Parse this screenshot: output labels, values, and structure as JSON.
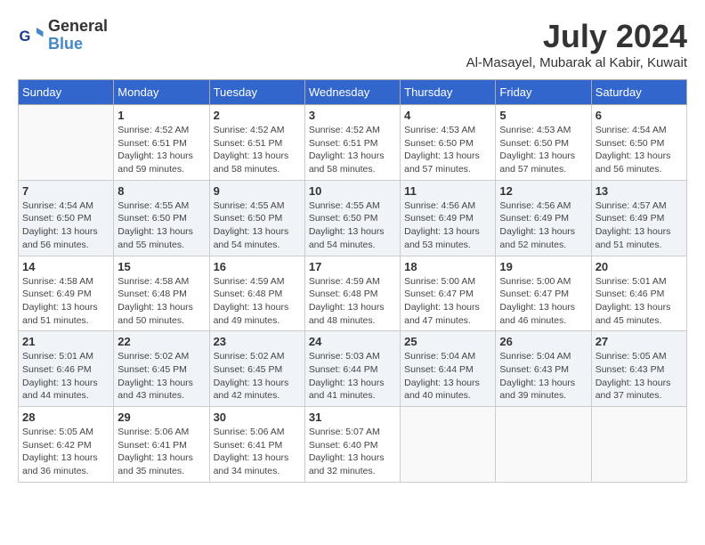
{
  "header": {
    "logo_line1": "General",
    "logo_line2": "Blue",
    "month": "July 2024",
    "location": "Al-Masayel, Mubarak al Kabir, Kuwait"
  },
  "days_of_week": [
    "Sunday",
    "Monday",
    "Tuesday",
    "Wednesday",
    "Thursday",
    "Friday",
    "Saturday"
  ],
  "weeks": [
    [
      {
        "day": "",
        "info": ""
      },
      {
        "day": "1",
        "info": "Sunrise: 4:52 AM\nSunset: 6:51 PM\nDaylight: 13 hours\nand 59 minutes."
      },
      {
        "day": "2",
        "info": "Sunrise: 4:52 AM\nSunset: 6:51 PM\nDaylight: 13 hours\nand 58 minutes."
      },
      {
        "day": "3",
        "info": "Sunrise: 4:52 AM\nSunset: 6:51 PM\nDaylight: 13 hours\nand 58 minutes."
      },
      {
        "day": "4",
        "info": "Sunrise: 4:53 AM\nSunset: 6:50 PM\nDaylight: 13 hours\nand 57 minutes."
      },
      {
        "day": "5",
        "info": "Sunrise: 4:53 AM\nSunset: 6:50 PM\nDaylight: 13 hours\nand 57 minutes."
      },
      {
        "day": "6",
        "info": "Sunrise: 4:54 AM\nSunset: 6:50 PM\nDaylight: 13 hours\nand 56 minutes."
      }
    ],
    [
      {
        "day": "7",
        "info": "Sunrise: 4:54 AM\nSunset: 6:50 PM\nDaylight: 13 hours\nand 56 minutes."
      },
      {
        "day": "8",
        "info": "Sunrise: 4:55 AM\nSunset: 6:50 PM\nDaylight: 13 hours\nand 55 minutes."
      },
      {
        "day": "9",
        "info": "Sunrise: 4:55 AM\nSunset: 6:50 PM\nDaylight: 13 hours\nand 54 minutes."
      },
      {
        "day": "10",
        "info": "Sunrise: 4:55 AM\nSunset: 6:50 PM\nDaylight: 13 hours\nand 54 minutes."
      },
      {
        "day": "11",
        "info": "Sunrise: 4:56 AM\nSunset: 6:49 PM\nDaylight: 13 hours\nand 53 minutes."
      },
      {
        "day": "12",
        "info": "Sunrise: 4:56 AM\nSunset: 6:49 PM\nDaylight: 13 hours\nand 52 minutes."
      },
      {
        "day": "13",
        "info": "Sunrise: 4:57 AM\nSunset: 6:49 PM\nDaylight: 13 hours\nand 51 minutes."
      }
    ],
    [
      {
        "day": "14",
        "info": "Sunrise: 4:58 AM\nSunset: 6:49 PM\nDaylight: 13 hours\nand 51 minutes."
      },
      {
        "day": "15",
        "info": "Sunrise: 4:58 AM\nSunset: 6:48 PM\nDaylight: 13 hours\nand 50 minutes."
      },
      {
        "day": "16",
        "info": "Sunrise: 4:59 AM\nSunset: 6:48 PM\nDaylight: 13 hours\nand 49 minutes."
      },
      {
        "day": "17",
        "info": "Sunrise: 4:59 AM\nSunset: 6:48 PM\nDaylight: 13 hours\nand 48 minutes."
      },
      {
        "day": "18",
        "info": "Sunrise: 5:00 AM\nSunset: 6:47 PM\nDaylight: 13 hours\nand 47 minutes."
      },
      {
        "day": "19",
        "info": "Sunrise: 5:00 AM\nSunset: 6:47 PM\nDaylight: 13 hours\nand 46 minutes."
      },
      {
        "day": "20",
        "info": "Sunrise: 5:01 AM\nSunset: 6:46 PM\nDaylight: 13 hours\nand 45 minutes."
      }
    ],
    [
      {
        "day": "21",
        "info": "Sunrise: 5:01 AM\nSunset: 6:46 PM\nDaylight: 13 hours\nand 44 minutes."
      },
      {
        "day": "22",
        "info": "Sunrise: 5:02 AM\nSunset: 6:45 PM\nDaylight: 13 hours\nand 43 minutes."
      },
      {
        "day": "23",
        "info": "Sunrise: 5:02 AM\nSunset: 6:45 PM\nDaylight: 13 hours\nand 42 minutes."
      },
      {
        "day": "24",
        "info": "Sunrise: 5:03 AM\nSunset: 6:44 PM\nDaylight: 13 hours\nand 41 minutes."
      },
      {
        "day": "25",
        "info": "Sunrise: 5:04 AM\nSunset: 6:44 PM\nDaylight: 13 hours\nand 40 minutes."
      },
      {
        "day": "26",
        "info": "Sunrise: 5:04 AM\nSunset: 6:43 PM\nDaylight: 13 hours\nand 39 minutes."
      },
      {
        "day": "27",
        "info": "Sunrise: 5:05 AM\nSunset: 6:43 PM\nDaylight: 13 hours\nand 37 minutes."
      }
    ],
    [
      {
        "day": "28",
        "info": "Sunrise: 5:05 AM\nSunset: 6:42 PM\nDaylight: 13 hours\nand 36 minutes."
      },
      {
        "day": "29",
        "info": "Sunrise: 5:06 AM\nSunset: 6:41 PM\nDaylight: 13 hours\nand 35 minutes."
      },
      {
        "day": "30",
        "info": "Sunrise: 5:06 AM\nSunset: 6:41 PM\nDaylight: 13 hours\nand 34 minutes."
      },
      {
        "day": "31",
        "info": "Sunrise: 5:07 AM\nSunset: 6:40 PM\nDaylight: 13 hours\nand 32 minutes."
      },
      {
        "day": "",
        "info": ""
      },
      {
        "day": "",
        "info": ""
      },
      {
        "day": "",
        "info": ""
      }
    ]
  ]
}
